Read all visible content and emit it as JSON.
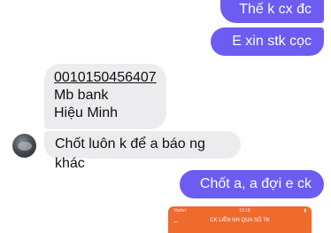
{
  "messages": {
    "out_1": "Thế k cx đc",
    "out_2": "E xin stk cọc",
    "in_account": {
      "number": "0010150456407",
      "bank": "Mb bank",
      "name": "Hiệu Minh"
    },
    "in_2": "Chốt luôn k để a báo ng khác",
    "out_3": "Chốt a,  a đợi e ck"
  },
  "colors": {
    "outgoing_bubble": "#6c5cf2",
    "incoming_bubble": "#ececee",
    "attachment_header": "#ee6a2d"
  },
  "attachment": {
    "carrier": "Viettel",
    "time": "19:18",
    "title": "CK LIÊN NH QUA SỐ TK",
    "back_icon": "arrow-left-icon"
  }
}
